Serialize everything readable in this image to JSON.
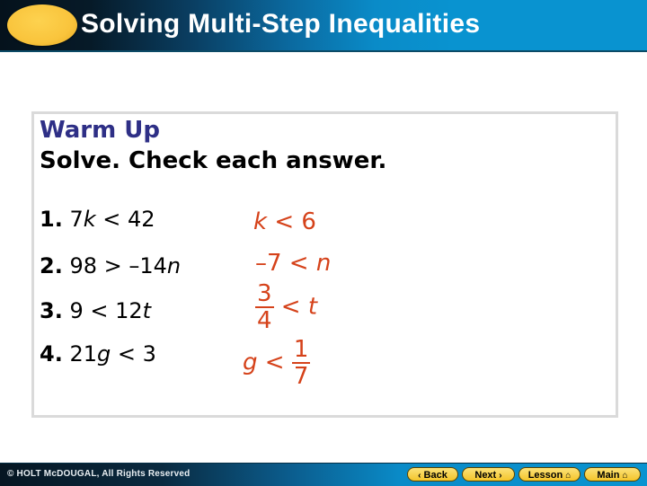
{
  "header": {
    "title": "Solving Multi-Step Inequalities",
    "logo_color": "#f9c43c"
  },
  "warmup": {
    "heading": "Warm Up",
    "instruction": "Solve. Check each answer.",
    "problems": [
      {
        "number": "1.",
        "before": "7",
        "var": "k",
        "after": " < 42"
      },
      {
        "number": "2.",
        "before": "98 > –14",
        "var": "n",
        "after": ""
      },
      {
        "number": "3.",
        "before": "9 < 12",
        "var": "t",
        "after": ""
      },
      {
        "number": "4.",
        "before": "21",
        "var": "g",
        "after": " < 3"
      }
    ],
    "answers": [
      {
        "text_var": "k",
        "text_rest": " < 6"
      },
      {
        "text_pre": "–7 < ",
        "text_var": "n"
      },
      {
        "num": "3",
        "den": "4",
        "rest": " < ",
        "var": "t"
      },
      {
        "var": "g",
        "rest": " < ",
        "num": "1",
        "den": "7"
      }
    ],
    "answer_color": "#d5421a",
    "heading_color": "#2e2f86"
  },
  "footer": {
    "copyright": "© HOLT McDOUGAL, All Rights Reserved",
    "buttons": {
      "back": "Back",
      "next": "Next",
      "lesson": "Lesson",
      "main": "Main"
    },
    "icons": {
      "back": "‹",
      "next": "›",
      "home": "⌂"
    }
  }
}
